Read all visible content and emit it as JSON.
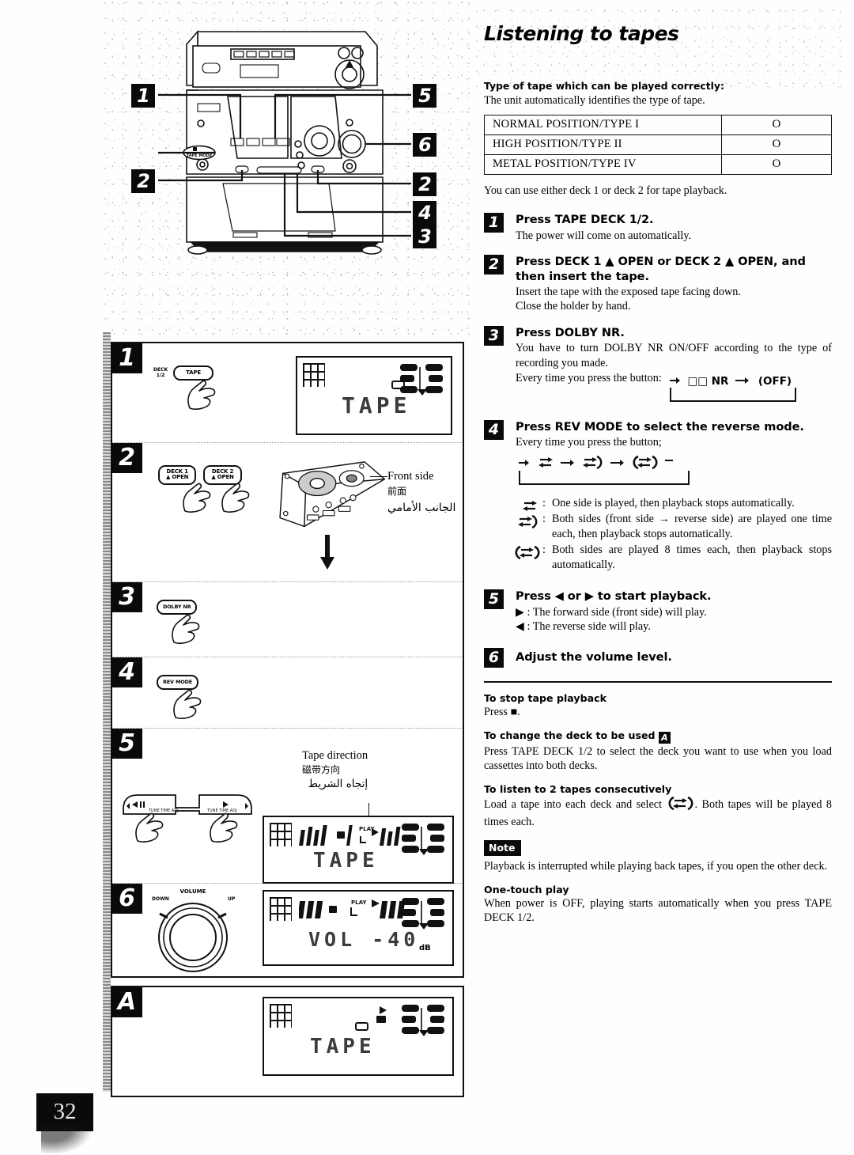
{
  "page": {
    "number": "32"
  },
  "section": {
    "title": "Listening to tapes"
  },
  "tape_type": {
    "heading": "Type of tape which can be played correctly:",
    "intro": "The unit automatically identifies the type of tape.",
    "rows": [
      {
        "label": "NORMAL POSITION/TYPE I",
        "mark": "O"
      },
      {
        "label": "HIGH POSITION/TYPE II",
        "mark": "O"
      },
      {
        "label": "METAL POSITION/TYPE IV",
        "mark": "O"
      }
    ],
    "note": "You can use either deck 1 or deck 2 for tape playback."
  },
  "steps": [
    {
      "num": "1",
      "head": "Press TAPE DECK 1/2.",
      "body": "The power will come on automatically."
    },
    {
      "num": "2",
      "head": "Press DECK 1 ▲ OPEN or DECK 2 ▲ OPEN, and then insert the tape.",
      "body": "Insert the tape with the exposed tape facing down.\nClose the holder by hand."
    },
    {
      "num": "3",
      "head": "Press DOLBY NR.",
      "body": "You have to turn DOLBY NR ON/OFF according to the type of recording you made.",
      "cycle_label": "Every time you press the button:",
      "cycle_items": [
        "□□ NR",
        "(OFF)"
      ]
    },
    {
      "num": "4",
      "head": "Press REV MODE to select the reverse mode.",
      "body": "Every time you press the button;",
      "legend": [
        {
          "glyph": "one-side",
          "text": "One side is played, then playback stops automatically."
        },
        {
          "glyph": "both-sides-once",
          "text": "Both sides (front side → reverse side) are played one time each, then playback stops automatically."
        },
        {
          "glyph": "both-sides-repeat",
          "text": "Both sides are played 8 times each, then playback stops automatically."
        }
      ]
    },
    {
      "num": "5",
      "head": "Press ◀ or ▶ to start playback.",
      "lines": [
        {
          "sym": "▶",
          "text": "The forward side (front side) will play."
        },
        {
          "sym": "◀",
          "text": "The reverse side will play."
        }
      ]
    },
    {
      "num": "6",
      "head": "Adjust the volume level.",
      "body": ""
    }
  ],
  "extras": [
    {
      "head": "To stop tape playback",
      "body": "Press ■."
    },
    {
      "head": "To change the deck to be used",
      "head_badge": "A",
      "body": "Press TAPE DECK 1/2 to select the deck you want to use when you load cassettes into both decks."
    },
    {
      "head": "To listen to 2 tapes consecutively",
      "body_pre": "Load a tape into each deck and select",
      "body_post": ". Both tapes will be played 8 times each."
    }
  ],
  "note": {
    "tag": "Note",
    "body": "Playback is interrupted while playing back tapes, if you open the other deck."
  },
  "one_touch": {
    "head": "One-touch play",
    "body": "When power is OFF, playing starts automatically when you press TAPE DECK 1/2."
  },
  "diagram": {
    "callouts": [
      "1",
      "5",
      "6",
      "2",
      "2",
      "4",
      "3"
    ],
    "device_button_label": "TAPE MODE"
  },
  "panels": {
    "step1": {
      "badge": "1",
      "button_caption": "DECK\n1/2",
      "button_label": "TAPE",
      "display_text": "TAPE"
    },
    "step2": {
      "badge": "2",
      "button1_line1": "DECK 1",
      "button1_line2": "▲ OPEN",
      "button2_line1": "DECK 2",
      "button2_line2": "▲ OPEN",
      "cassette_label_en": "Front side",
      "cassette_label_cn": "前面",
      "cassette_label_ar": "الجانب الأمامي"
    },
    "step3": {
      "badge": "3",
      "button_label": "DOLBY NR"
    },
    "step4": {
      "badge": "4",
      "button_label": "REV MODE"
    },
    "step5": {
      "badge": "5",
      "button_left": "TUNE TIME ADJ",
      "button_right": "TUNE TIME ADJ",
      "direction_label_en": "Tape direction",
      "direction_label_cn": "磁带方向",
      "direction_label_ar": "إتجاه الشريط",
      "display_text": "TAPE",
      "display_play": "PLAY"
    },
    "step6": {
      "badge": "6",
      "knob_label": "VOLUME",
      "knob_down": "DOWN",
      "knob_up": "UP",
      "display_text": "VOL  -40",
      "display_unit": "dB",
      "display_play": "PLAY"
    },
    "panelA": {
      "badge": "A",
      "display_text": "TAPE"
    }
  }
}
